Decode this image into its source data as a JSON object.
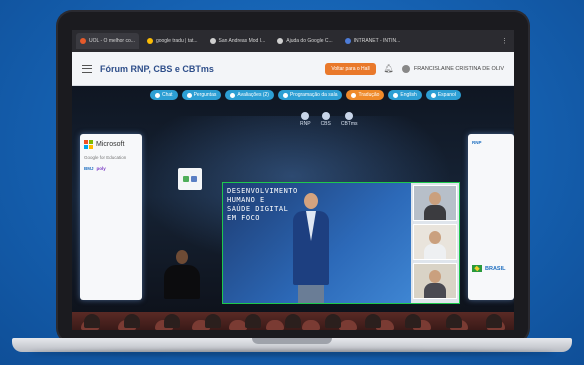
{
  "browser": {
    "tabs": [
      {
        "label": "UOL - O melhor co...",
        "icon": "uol-favicon"
      },
      {
        "label": "google tradu | tat...",
        "icon": "google-favicon"
      },
      {
        "label": "San Andreas Mod I...",
        "icon": "globe-favicon"
      },
      {
        "label": "Ajuda do Google C...",
        "icon": "help-favicon"
      },
      {
        "label": "INTRANET - INTIN...",
        "icon": "intranet-favicon"
      }
    ]
  },
  "header": {
    "title": "Fórum RNP, CBS e CBTms",
    "back_label": "Voltar para o Hall",
    "user_name": "FRANCISLAINE CRISTINA DE OLIV"
  },
  "stage": {
    "chips": [
      {
        "label": "Chat",
        "color": "#2d9fd4"
      },
      {
        "label": "Perguntas",
        "color": "#2d9fd4"
      },
      {
        "label": "Avaliações (2)",
        "color": "#2d9fd4"
      },
      {
        "label": "Programação da sala",
        "color": "#2d9fd4"
      },
      {
        "label": "Tradução",
        "color": "#ef8a2a"
      },
      {
        "label": "English",
        "color": "#2d9fd4"
      },
      {
        "label": "Espanol",
        "color": "#2d9fd4"
      }
    ],
    "top_logos": [
      "RNP",
      "CBS",
      "CBTms"
    ],
    "slide_text": "DESENVOLVIMENTO\nHUMANO E\nSAÚDE DIGITAL\nEM FOCO"
  },
  "left_banner": {
    "microsoft": "Microsoft",
    "google": "Google for Education",
    "bmj": "BMJ",
    "poly": "poly"
  },
  "right_banner": {
    "rnp": "RNP",
    "brasil": "BRASIL"
  },
  "colors": {
    "background": "#1565b8",
    "accent_green": "#1ec84d",
    "back_button": "#e9792b"
  }
}
